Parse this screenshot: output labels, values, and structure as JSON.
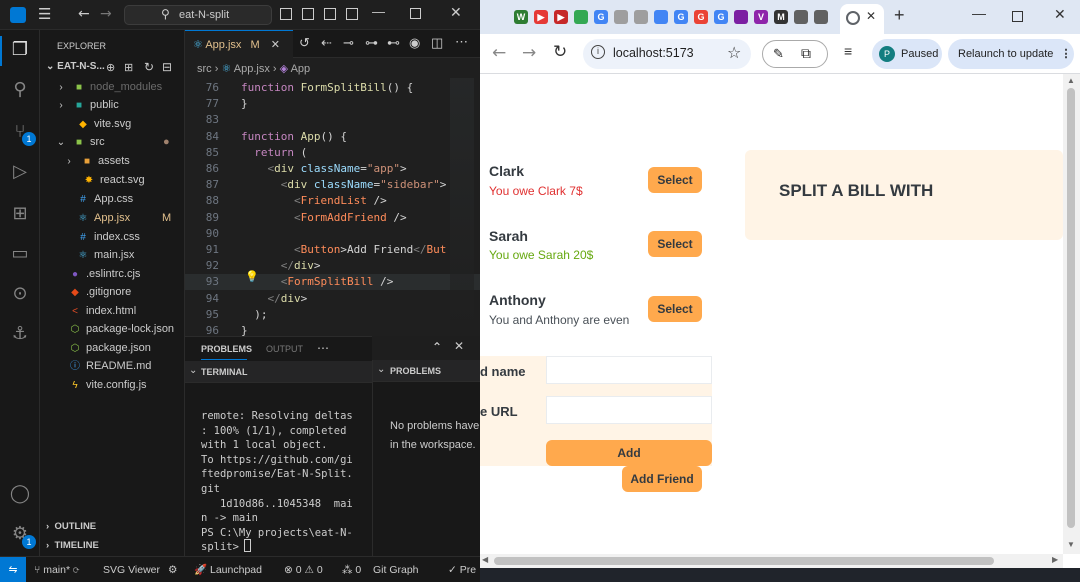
{
  "vscode": {
    "title": "eat-N-split",
    "explorer": {
      "header": "EXPLORER",
      "project": "EAT-N-S...",
      "items": [
        {
          "label": "node_modules",
          "icon": "folder-icon",
          "status": "dim"
        },
        {
          "label": "public",
          "icon": "folder-icon",
          "status": ""
        },
        {
          "label": "vite.svg",
          "icon": "svg-file-icon",
          "status": ""
        },
        {
          "label": "src",
          "icon": "folder-icon",
          "status": ""
        },
        {
          "label": "assets",
          "icon": "folder-icon",
          "status": ""
        },
        {
          "label": "react.svg",
          "icon": "react-file-icon",
          "status": ""
        },
        {
          "label": "App.css",
          "icon": "css-file-icon",
          "status": ""
        },
        {
          "label": "App.jsx",
          "icon": "react-file-icon",
          "status": "M"
        },
        {
          "label": "index.css",
          "icon": "css-file-icon",
          "status": ""
        },
        {
          "label": "main.jsx",
          "icon": "react-file-icon",
          "status": ""
        },
        {
          "label": ".eslintrc.cjs",
          "icon": "eslint-file-icon",
          "status": ""
        },
        {
          "label": ".gitignore",
          "icon": "git-file-icon",
          "status": ""
        },
        {
          "label": "index.html",
          "icon": "html-file-icon",
          "status": ""
        },
        {
          "label": "package-lock.json",
          "icon": "json-file-icon",
          "status": ""
        },
        {
          "label": "package.json",
          "icon": "json-file-icon",
          "status": ""
        },
        {
          "label": "README.md",
          "icon": "info-file-icon",
          "status": ""
        },
        {
          "label": "vite.config.js",
          "icon": "js-file-icon",
          "status": ""
        }
      ],
      "outline": "OUTLINE",
      "timeline": "TIMELINE"
    },
    "tab": {
      "label": "App.jsx",
      "status": "M"
    },
    "breadcrumb": {
      "folder": "src",
      "file": "App.jsx",
      "symbol": "App"
    },
    "code": [
      {
        "ln": "76",
        "text": "function FormSplitBill() {"
      },
      {
        "ln": "77",
        "text": "}"
      },
      {
        "ln": "83",
        "text": ""
      },
      {
        "ln": "84",
        "text": "function App() {"
      },
      {
        "ln": "85",
        "text": "  return ("
      },
      {
        "ln": "86",
        "text": "    <div className=\"app\">"
      },
      {
        "ln": "87",
        "text": "      <div className=\"sidebar\">"
      },
      {
        "ln": "88",
        "text": "        <FriendList />"
      },
      {
        "ln": "89",
        "text": "        <FormAddFriend />"
      },
      {
        "ln": "90",
        "text": ""
      },
      {
        "ln": "91",
        "text": "        <Button>Add Friend</But"
      },
      {
        "ln": "92",
        "text": "      </div>"
      },
      {
        "ln": "93",
        "text": "      <FormSplitBill />"
      },
      {
        "ln": "94",
        "text": "    </div>"
      },
      {
        "ln": "95",
        "text": "  );"
      },
      {
        "ln": "96",
        "text": "}"
      }
    ],
    "panel": {
      "tabs": [
        "PROBLEMS",
        "OUTPUT"
      ],
      "terminal_header": "TERMINAL",
      "problems_header": "PROBLEMS",
      "terminal_lines": [
        "remote: Resolving deltas",
        ": 100% (1/1), completed",
        "with 1 local object.",
        "To https://github.com/gi",
        "ftedpromise/Eat-N-Split.",
        "git",
        "   1d10d86..1045348  mai",
        "n -> main",
        "PS C:\\My projects\\eat-N-",
        "split> "
      ],
      "problems_text": [
        "No problems have",
        "in the workspace."
      ]
    },
    "status": {
      "branch": "main*",
      "svg_viewer": "SVG Viewer",
      "launchpad": "Launchpad",
      "errors": "0",
      "warnings": "0",
      "ports": "0",
      "git_graph": "Git Graph",
      "prettier": "Pre"
    }
  },
  "chrome": {
    "url": "localhost:5173",
    "profile_label": "Paused",
    "profile_initial": "P",
    "relaunch": "Relaunch to update",
    "favicons": [
      {
        "letter": "W",
        "color": "#2e7d32"
      },
      {
        "letter": "▶",
        "color": "#e53935"
      },
      {
        "letter": "▶",
        "color": "#c62828"
      },
      {
        "letter": "",
        "color": "#34a853"
      },
      {
        "letter": "G",
        "color": "#4285f4"
      },
      {
        "letter": "",
        "color": "#9e9e9e"
      },
      {
        "letter": "",
        "color": "#9e9e9e"
      },
      {
        "letter": "",
        "color": "#4285f4"
      },
      {
        "letter": "G",
        "color": "#4285f4"
      },
      {
        "letter": "G",
        "color": "#ea4335"
      },
      {
        "letter": "G",
        "color": "#4285f4"
      },
      {
        "letter": "",
        "color": "#7b1fa2"
      },
      {
        "letter": "V",
        "color": "#8e24aa"
      },
      {
        "letter": "M",
        "color": "#333333"
      },
      {
        "letter": "",
        "color": "#616161"
      },
      {
        "letter": "",
        "color": "#616161"
      }
    ]
  },
  "app": {
    "friends": [
      {
        "name": "Clark",
        "balance": "You owe Clark 7$",
        "balance_color": "#e03131",
        "button": "Select"
      },
      {
        "name": "Sarah",
        "balance": "You owe Sarah 20$",
        "balance_color": "#66a80f",
        "button": "Select"
      },
      {
        "name": "Anthony",
        "balance": "You and Anthony are even",
        "balance_color": "#495057",
        "button": "Select"
      }
    ],
    "add_form": {
      "name_label": "d name",
      "image_label": "e URL",
      "add_button": "Add"
    },
    "add_friend_button": "Add Friend",
    "split_heading": "SPLIT A BILL WITH",
    "colors": {
      "accent": "#ffa94d",
      "panel_bg": "#fff4e6",
      "text": "#343a40"
    }
  }
}
